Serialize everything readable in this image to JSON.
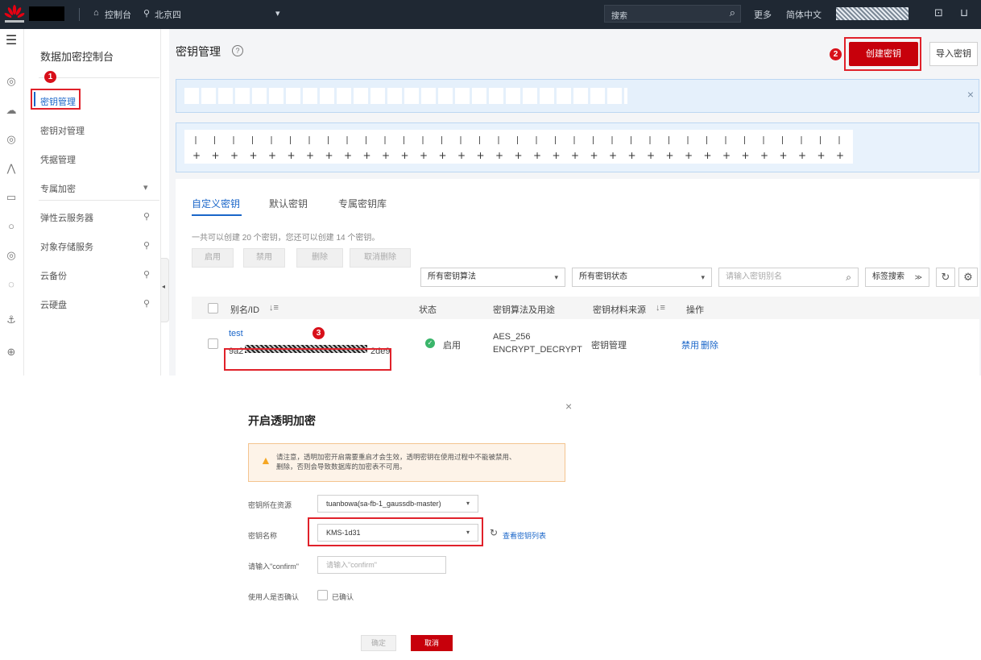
{
  "topbar": {
    "console_label": "控制台",
    "region_label": "北京四",
    "search_label": "搜索",
    "more_label": "更多",
    "language_label": "简体中文",
    "brand_color": "#c7000b"
  },
  "nav": {
    "title": "数据加密控制台",
    "items": [
      {
        "label": "密钥管理"
      },
      {
        "label": "密钥对管理"
      },
      {
        "label": "凭据管理"
      },
      {
        "label": "专属加密"
      },
      {
        "label": "弹性云服务器"
      },
      {
        "label": "对象存储服务"
      },
      {
        "label": "云备份"
      },
      {
        "label": "云硬盘"
      }
    ]
  },
  "main": {
    "page_title": "密钥管理",
    "create_button": "创建密钥",
    "import_button": "导入密钥",
    "badges": [
      "1",
      "2",
      "3"
    ],
    "tabs": [
      "自定义密钥",
      "默认密钥",
      "专属密钥库"
    ],
    "quota_text": "一共可以创建 20 个密钥，您还可以创建 14 个密钥。",
    "action_buttons": [
      "启用",
      "禁用",
      "删除",
      "取消删除"
    ],
    "filter_algorithm": "所有密钥算法",
    "filter_status": "所有密钥状态",
    "search_placeholder": "请输入密钥别名",
    "tag_search": "标签搜索",
    "table": {
      "columns": [
        "别名/ID",
        "状态",
        "密钥算法及用途",
        "密钥材料来源",
        "操作"
      ],
      "rows": [
        {
          "alias": "test",
          "id_prefix": "9a2",
          "id_suffix": "2de9",
          "status": "启用",
          "algorithm": "AES_256",
          "usage": "ENCRYPT_DECRYPT",
          "source": "密钥管理",
          "actions": [
            "禁用",
            "删除"
          ]
        }
      ]
    }
  },
  "dialog": {
    "title": "开启透明加密",
    "warning_line1": "请注意，透明加密开启需要重启才会生效，透明密钥在使用过程中不能被禁用、",
    "warning_line2": "删除，否则会导致数据库的加密表不可用。",
    "resource_label": "密钥所在资源",
    "resource_value": "tuanbowa(sa-fb-1_gaussdb-master)",
    "key_name_label": "密钥名称",
    "key_name_value": "KMS-1d31",
    "view_keys_link": "查看密钥列表",
    "confirm_label": "请输入\"confirm\"",
    "confirm_placeholder": "请输入\"confirm\"",
    "user_confirm_label": "使用人是否确认",
    "confirmed_label": "已确认",
    "ok_button": "确定",
    "cancel_button": "取消"
  }
}
